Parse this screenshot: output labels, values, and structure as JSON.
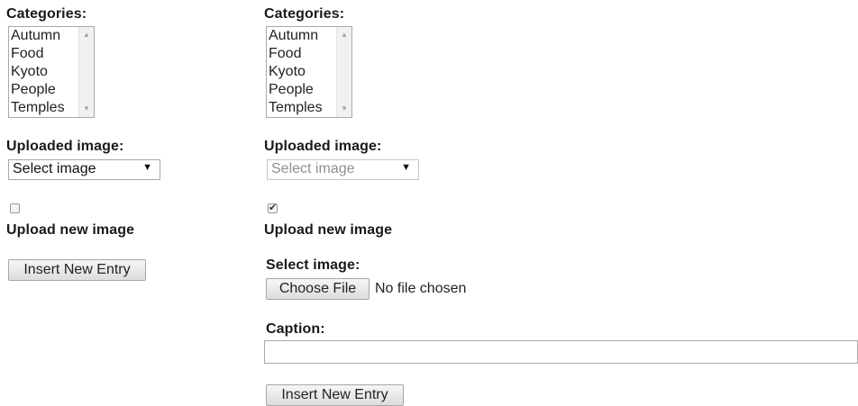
{
  "left_form": {
    "categories_label": "Categories:",
    "categories": [
      "Autumn",
      "Food",
      "Kyoto",
      "People",
      "Temples"
    ],
    "uploaded_image_label": "Uploaded image:",
    "uploaded_image_value": "Select image",
    "upload_new_checked": false,
    "upload_new_label": "Upload new image",
    "submit_label": "Insert New Entry"
  },
  "right_form": {
    "categories_label": "Categories:",
    "categories": [
      "Autumn",
      "Food",
      "Kyoto",
      "People",
      "Temples"
    ],
    "uploaded_image_label": "Uploaded image:",
    "uploaded_image_value": "Select image",
    "uploaded_image_disabled": true,
    "upload_new_checked": true,
    "upload_new_label": "Upload new image",
    "select_image_label": "Select image:",
    "choose_file_label": "Choose File",
    "no_file_text": "No file chosen",
    "caption_label": "Caption:",
    "caption_value": "",
    "submit_label": "Insert New Entry"
  },
  "icons": {
    "scroll_up": "scroll-up-arrow-icon",
    "scroll_down": "scroll-down-arrow-icon",
    "dropdown": "dropdown-caret-icon",
    "check": "checkmark-icon"
  }
}
